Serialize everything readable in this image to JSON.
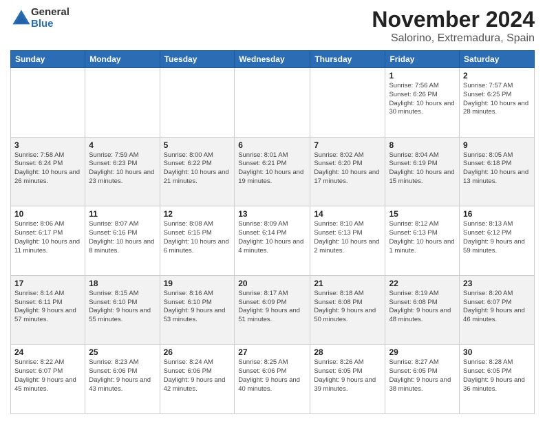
{
  "logo": {
    "general": "General",
    "blue": "Blue"
  },
  "title": {
    "month": "November 2024",
    "location": "Salorino, Extremadura, Spain"
  },
  "weekdays": [
    "Sunday",
    "Monday",
    "Tuesday",
    "Wednesday",
    "Thursday",
    "Friday",
    "Saturday"
  ],
  "weeks": [
    {
      "days": [
        {
          "num": "",
          "info": ""
        },
        {
          "num": "",
          "info": ""
        },
        {
          "num": "",
          "info": ""
        },
        {
          "num": "",
          "info": ""
        },
        {
          "num": "",
          "info": ""
        },
        {
          "num": "1",
          "info": "Sunrise: 7:56 AM\nSunset: 6:26 PM\nDaylight: 10 hours and 30 minutes."
        },
        {
          "num": "2",
          "info": "Sunrise: 7:57 AM\nSunset: 6:25 PM\nDaylight: 10 hours and 28 minutes."
        }
      ]
    },
    {
      "days": [
        {
          "num": "3",
          "info": "Sunrise: 7:58 AM\nSunset: 6:24 PM\nDaylight: 10 hours and 26 minutes."
        },
        {
          "num": "4",
          "info": "Sunrise: 7:59 AM\nSunset: 6:23 PM\nDaylight: 10 hours and 23 minutes."
        },
        {
          "num": "5",
          "info": "Sunrise: 8:00 AM\nSunset: 6:22 PM\nDaylight: 10 hours and 21 minutes."
        },
        {
          "num": "6",
          "info": "Sunrise: 8:01 AM\nSunset: 6:21 PM\nDaylight: 10 hours and 19 minutes."
        },
        {
          "num": "7",
          "info": "Sunrise: 8:02 AM\nSunset: 6:20 PM\nDaylight: 10 hours and 17 minutes."
        },
        {
          "num": "8",
          "info": "Sunrise: 8:04 AM\nSunset: 6:19 PM\nDaylight: 10 hours and 15 minutes."
        },
        {
          "num": "9",
          "info": "Sunrise: 8:05 AM\nSunset: 6:18 PM\nDaylight: 10 hours and 13 minutes."
        }
      ]
    },
    {
      "days": [
        {
          "num": "10",
          "info": "Sunrise: 8:06 AM\nSunset: 6:17 PM\nDaylight: 10 hours and 11 minutes."
        },
        {
          "num": "11",
          "info": "Sunrise: 8:07 AM\nSunset: 6:16 PM\nDaylight: 10 hours and 8 minutes."
        },
        {
          "num": "12",
          "info": "Sunrise: 8:08 AM\nSunset: 6:15 PM\nDaylight: 10 hours and 6 minutes."
        },
        {
          "num": "13",
          "info": "Sunrise: 8:09 AM\nSunset: 6:14 PM\nDaylight: 10 hours and 4 minutes."
        },
        {
          "num": "14",
          "info": "Sunrise: 8:10 AM\nSunset: 6:13 PM\nDaylight: 10 hours and 2 minutes."
        },
        {
          "num": "15",
          "info": "Sunrise: 8:12 AM\nSunset: 6:13 PM\nDaylight: 10 hours and 1 minute."
        },
        {
          "num": "16",
          "info": "Sunrise: 8:13 AM\nSunset: 6:12 PM\nDaylight: 9 hours and 59 minutes."
        }
      ]
    },
    {
      "days": [
        {
          "num": "17",
          "info": "Sunrise: 8:14 AM\nSunset: 6:11 PM\nDaylight: 9 hours and 57 minutes."
        },
        {
          "num": "18",
          "info": "Sunrise: 8:15 AM\nSunset: 6:10 PM\nDaylight: 9 hours and 55 minutes."
        },
        {
          "num": "19",
          "info": "Sunrise: 8:16 AM\nSunset: 6:10 PM\nDaylight: 9 hours and 53 minutes."
        },
        {
          "num": "20",
          "info": "Sunrise: 8:17 AM\nSunset: 6:09 PM\nDaylight: 9 hours and 51 minutes."
        },
        {
          "num": "21",
          "info": "Sunrise: 8:18 AM\nSunset: 6:08 PM\nDaylight: 9 hours and 50 minutes."
        },
        {
          "num": "22",
          "info": "Sunrise: 8:19 AM\nSunset: 6:08 PM\nDaylight: 9 hours and 48 minutes."
        },
        {
          "num": "23",
          "info": "Sunrise: 8:20 AM\nSunset: 6:07 PM\nDaylight: 9 hours and 46 minutes."
        }
      ]
    },
    {
      "days": [
        {
          "num": "24",
          "info": "Sunrise: 8:22 AM\nSunset: 6:07 PM\nDaylight: 9 hours and 45 minutes."
        },
        {
          "num": "25",
          "info": "Sunrise: 8:23 AM\nSunset: 6:06 PM\nDaylight: 9 hours and 43 minutes."
        },
        {
          "num": "26",
          "info": "Sunrise: 8:24 AM\nSunset: 6:06 PM\nDaylight: 9 hours and 42 minutes."
        },
        {
          "num": "27",
          "info": "Sunrise: 8:25 AM\nSunset: 6:06 PM\nDaylight: 9 hours and 40 minutes."
        },
        {
          "num": "28",
          "info": "Sunrise: 8:26 AM\nSunset: 6:05 PM\nDaylight: 9 hours and 39 minutes."
        },
        {
          "num": "29",
          "info": "Sunrise: 8:27 AM\nSunset: 6:05 PM\nDaylight: 9 hours and 38 minutes."
        },
        {
          "num": "30",
          "info": "Sunrise: 8:28 AM\nSunset: 6:05 PM\nDaylight: 9 hours and 36 minutes."
        }
      ]
    }
  ]
}
